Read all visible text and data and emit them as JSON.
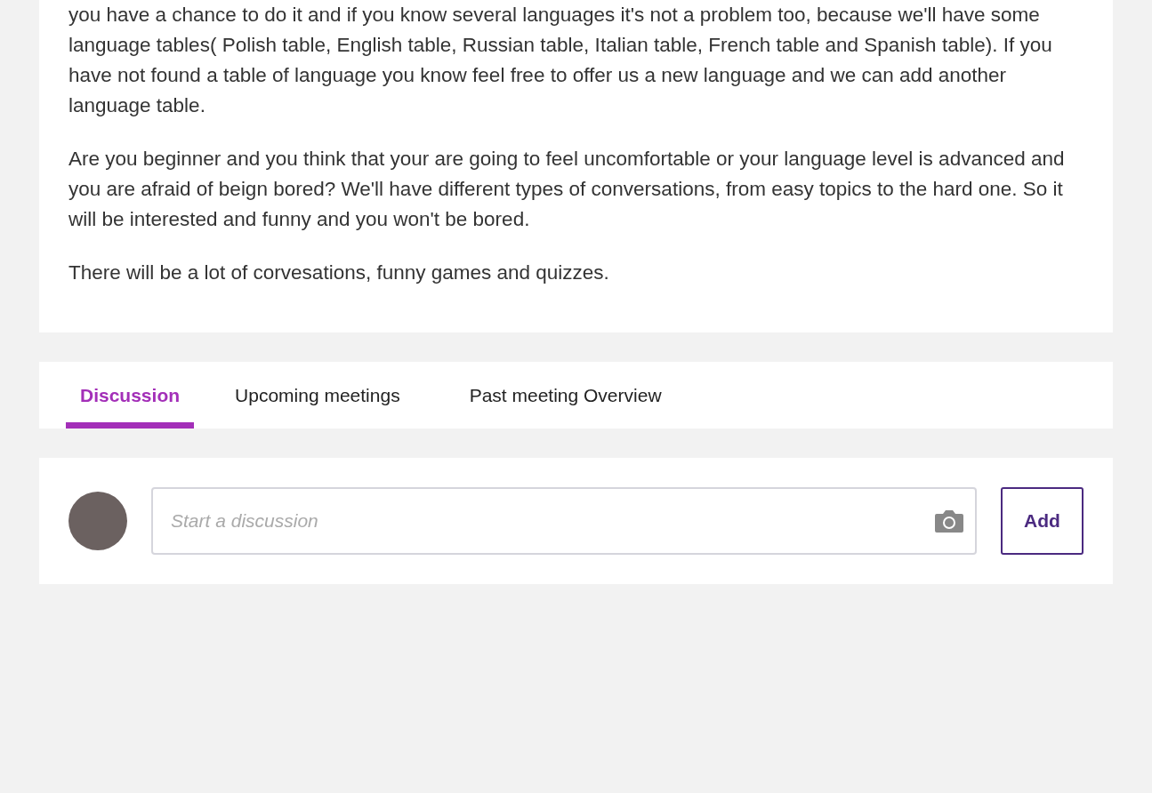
{
  "description": {
    "paragraphs": [
      "you have a chance to do it and if you know several languages it's not a problem too, because we'll have some language tables( Polish table, English table, Russian table, Italian table, French table and Spanish table). If you have not found a table of language you know feel free to offer us a new language and we can add another language table.",
      "Are you beginner and you think that your are going to feel uncomfortable or your language level is advanced and you are afraid of beign bored? We'll have different types of conversations, from easy topics to the hard one. So it will be interested and funny and you won't be bored.",
      "There will be a lot of corvesations, funny games and quizzes."
    ]
  },
  "tabs": [
    {
      "label": "Discussion",
      "selected": true
    },
    {
      "label": "Upcoming meetings",
      "selected": false
    },
    {
      "label": "Past meeting Overview",
      "selected": false
    }
  ],
  "discussion": {
    "placeholder": "Start a discussion",
    "button": "Add"
  }
}
